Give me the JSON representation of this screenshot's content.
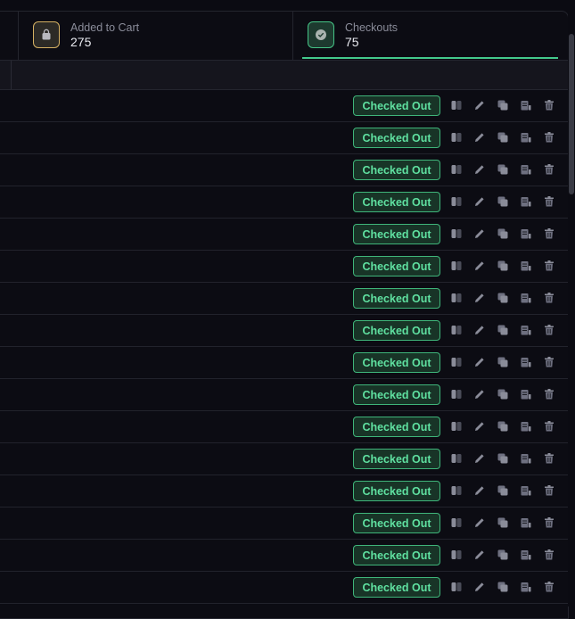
{
  "stats": {
    "cart": {
      "label": "Added to Cart",
      "value": "275",
      "icon": "shopping-bag-icon",
      "accent": "#d4b062"
    },
    "checkouts": {
      "label": "Checkouts",
      "value": "75",
      "icon": "check-circle-icon",
      "accent": "#43c98c",
      "active": true
    }
  },
  "rows": [
    {
      "status": "Checked Out"
    },
    {
      "status": "Checked Out"
    },
    {
      "status": "Checked Out"
    },
    {
      "status": "Checked Out"
    },
    {
      "status": "Checked Out"
    },
    {
      "status": "Checked Out"
    },
    {
      "status": "Checked Out"
    },
    {
      "status": "Checked Out"
    },
    {
      "status": "Checked Out"
    },
    {
      "status": "Checked Out"
    },
    {
      "status": "Checked Out"
    },
    {
      "status": "Checked Out"
    },
    {
      "status": "Checked Out"
    },
    {
      "status": "Checked Out"
    },
    {
      "status": "Checked Out"
    },
    {
      "status": "Checked Out"
    }
  ],
  "row_actions": [
    "toggle-icon",
    "edit-icon",
    "copy-icon",
    "document-icon",
    "delete-icon"
  ],
  "colors": {
    "status_text": "#5fe0a0",
    "status_border": "#3fb57a",
    "icon": "#6e7080"
  }
}
